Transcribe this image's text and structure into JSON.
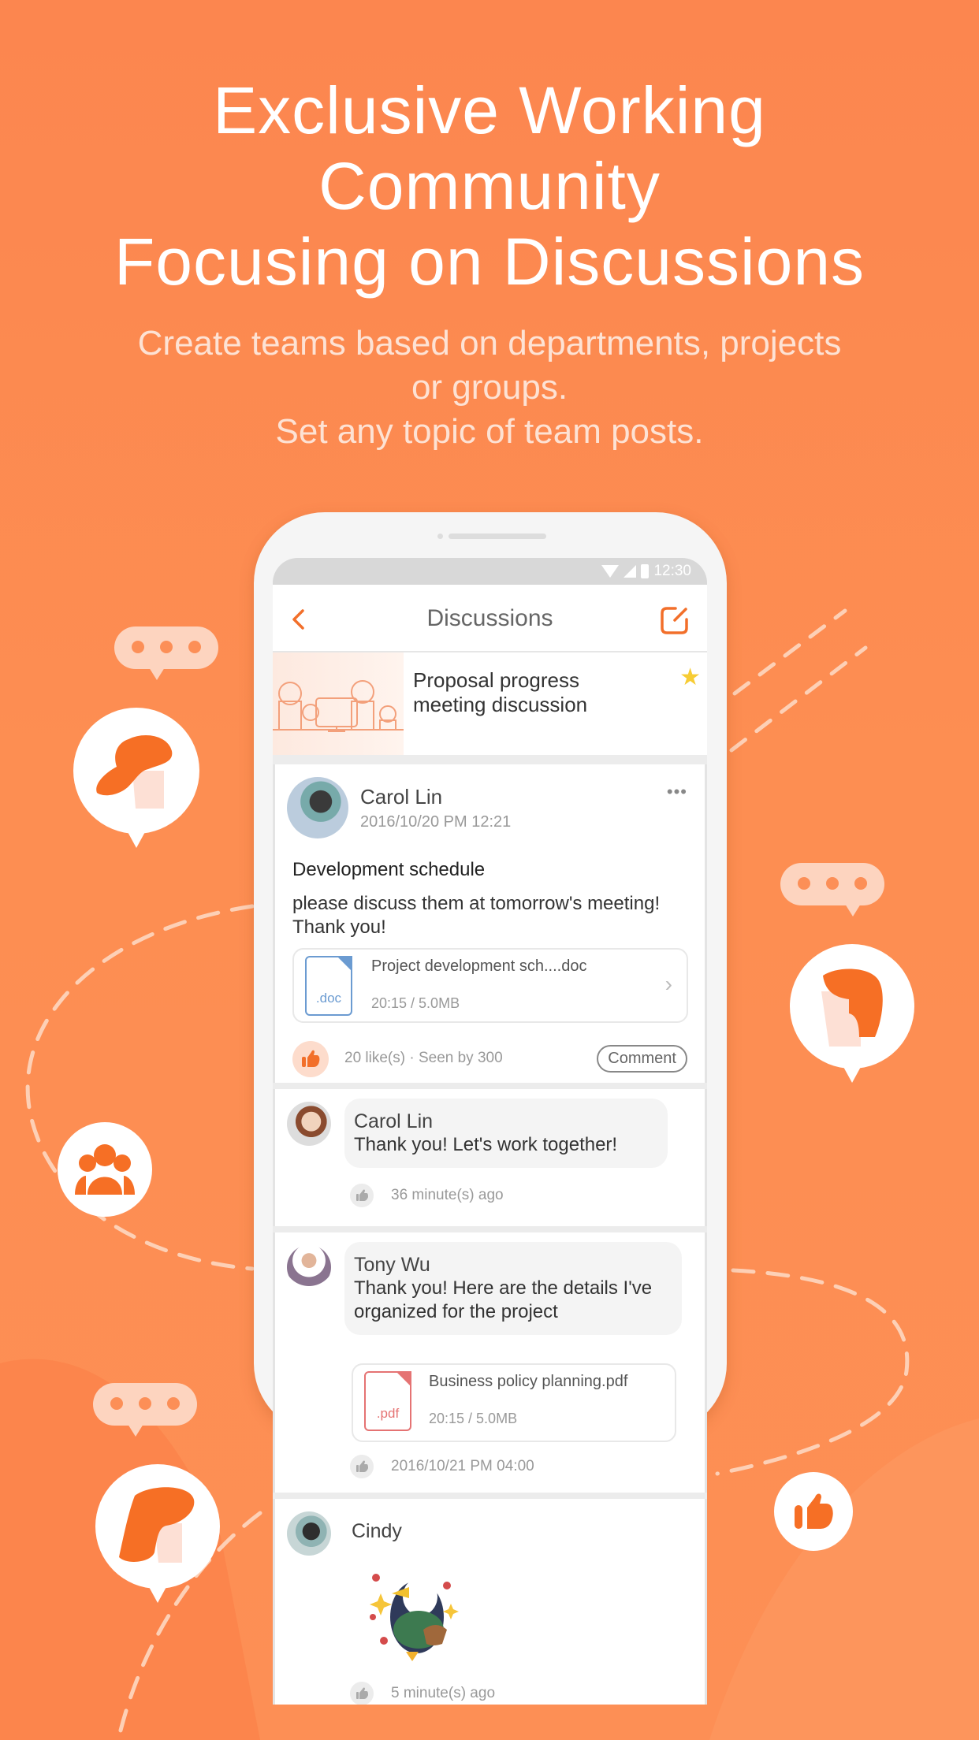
{
  "headline": {
    "lines": [
      "Exclusive Working",
      "Community",
      "Focusing on Discussions"
    ]
  },
  "subheadline": {
    "lines": [
      "Create teams based on departments, projects",
      "or groups.",
      "Set any topic of team posts."
    ]
  },
  "colors": {
    "brand_orange": "#fc864f",
    "accent_orange": "#f26f2a",
    "star_yellow": "#f7cc34",
    "doc_blue": "#6b9bd1",
    "pdf_red": "#e57373"
  },
  "status_bar": {
    "time": "12:30",
    "icons": [
      "wifi-icon",
      "cell-signal-icon",
      "battery-icon"
    ]
  },
  "nav": {
    "title": "Discussions",
    "back_icon": "chevron-left-icon",
    "compose_icon": "compose-icon"
  },
  "topic": {
    "title": "Proposal progress meeting discussion",
    "starred": true
  },
  "post": {
    "author": "Carol Lin",
    "timestamp": "2016/10/20 PM 12:21",
    "more_icon": "•••",
    "subject": "Development schedule",
    "body": "please discuss them at tomorrow's meeting! Thank you!",
    "attachment": {
      "ext_label": ".doc",
      "name": "Project development sch....doc",
      "meta": "20:15 / 5.0MB",
      "chevron": "›"
    },
    "stats": "20 like(s) · Seen by 300",
    "comment_label": "Comment"
  },
  "comments": [
    {
      "author": "Carol Lin",
      "text": "Thank you! Let's work together!",
      "time": "36 minute(s) ago"
    },
    {
      "author": "Tony Wu",
      "text": "Thank you! Here are the details I've organized for the project",
      "attachment": {
        "ext_label": ".pdf",
        "name": "Business policy planning.pdf",
        "meta": "20:15 / 5.0MB"
      },
      "time": "2016/10/21 PM 04:00"
    },
    {
      "author": "Cindy",
      "sticker": "penguin-sticker",
      "time": "5 minute(s) ago"
    }
  ]
}
